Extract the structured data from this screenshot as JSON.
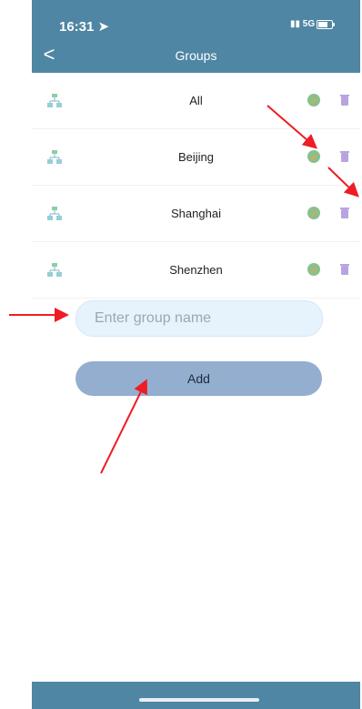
{
  "status_bar": {
    "time": "16:31",
    "network": "5G"
  },
  "header": {
    "title": "Groups",
    "back_symbol": "<"
  },
  "groups": [
    {
      "name": "All"
    },
    {
      "name": "Beijing"
    },
    {
      "name": "Shanghai"
    },
    {
      "name": "Shenzhen"
    }
  ],
  "add_form": {
    "placeholder": "Enter group name",
    "button_label": "Add"
  },
  "icons": {
    "group": "network-group-icon",
    "edit": "edit-icon",
    "delete": "trash-icon",
    "back": "chevron-left-icon"
  },
  "colors": {
    "header": "#4f86a3",
    "input_bg": "#e6f2fc",
    "button_bg": "#94aed0",
    "edit_icon": "#8bbf8e",
    "delete_icon": "#b8a5e0",
    "annotation_arrow": "#ee1c24"
  }
}
